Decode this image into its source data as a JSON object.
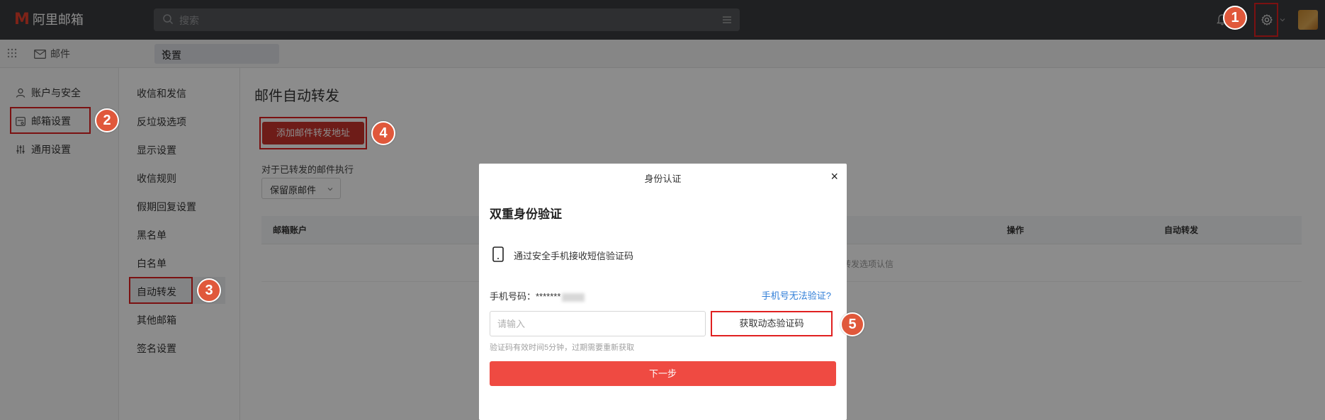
{
  "app": {
    "logo_text": "阿里邮箱",
    "search_placeholder": "搜索"
  },
  "tabs": {
    "mail": "邮件",
    "settings": "设置",
    "close": "×"
  },
  "sidebar1": {
    "items": [
      {
        "label": "账户与安全",
        "icon": "user-icon"
      },
      {
        "label": "邮箱设置",
        "icon": "mailbox-icon"
      },
      {
        "label": "通用设置",
        "icon": "sliders-icon"
      }
    ]
  },
  "sidebar2": {
    "items": [
      {
        "label": "收信和发信"
      },
      {
        "label": "反垃圾选项"
      },
      {
        "label": "显示设置"
      },
      {
        "label": "收信规则"
      },
      {
        "label": "假期回复设置"
      },
      {
        "label": "黑名单"
      },
      {
        "label": "白名单"
      },
      {
        "label": "自动转发"
      },
      {
        "label": "其他邮箱"
      },
      {
        "label": "签名设置"
      }
    ],
    "active": "自动转发"
  },
  "main": {
    "title": "邮件自动转发",
    "add_button": "添加邮件转发地址",
    "exec_label": "对于已转发的邮件执行",
    "keep_option": "保留原邮件",
    "columns": [
      "邮箱账户",
      "操作",
      "自动转发"
    ],
    "empty_text": "转发选项认信"
  },
  "modal": {
    "title": "身份认证",
    "close": "×",
    "heading": "双重身份验证",
    "method": "通过安全手机接收短信验证码",
    "phone_label": "手机号码：*******",
    "cannot_verify_link": "手机号无法验证?",
    "input_placeholder": "请输入",
    "get_code_button": "获取动态验证码",
    "hint": "验证码有效时间5分钟，过期需要重新获取",
    "next_button": "下一步"
  },
  "badges": [
    "1",
    "2",
    "3",
    "4",
    "5"
  ],
  "colors": {
    "topbar": "#3a3b3e",
    "brand_red": "#e5402d",
    "highlight_box": "#e02020",
    "badge": "#e0583b",
    "primary_button": "#ef4a42",
    "link": "#2f7ed8"
  }
}
